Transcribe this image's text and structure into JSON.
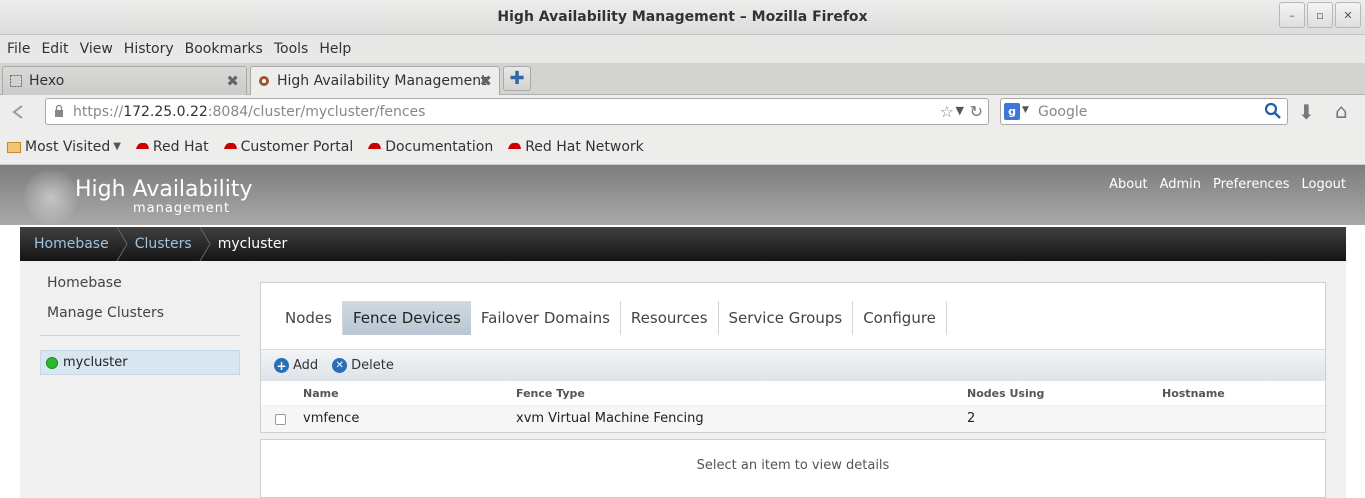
{
  "window": {
    "title": "High Availability Management – Mozilla Firefox"
  },
  "menu": [
    "File",
    "Edit",
    "View",
    "History",
    "Bookmarks",
    "Tools",
    "Help"
  ],
  "tabs": [
    {
      "label": "Hexo"
    },
    {
      "label": "High Availability Management"
    }
  ],
  "nav": {
    "url_prefix": "https://",
    "url_host": "172.25.0.22",
    "url_rest": ":8084/cluster/mycluster/fences",
    "search_placeholder": "Google"
  },
  "bookmarks": [
    "Most Visited",
    "Red Hat",
    "Customer Portal",
    "Documentation",
    "Red Hat Network"
  ],
  "app": {
    "title": "High Availability",
    "subtitle": "management",
    "toplinks": [
      "About",
      "Admin",
      "Preferences",
      "Logout"
    ]
  },
  "breadcrumb": [
    "Homebase",
    "Clusters",
    "mycluster"
  ],
  "sidebar": {
    "links": [
      "Homebase",
      "Manage Clusters"
    ],
    "cluster": "mycluster"
  },
  "panel": {
    "tabs": [
      "Nodes",
      "Fence Devices",
      "Failover Domains",
      "Resources",
      "Service Groups",
      "Configure"
    ],
    "active_tab": "Fence Devices",
    "toolbar": {
      "add": "Add",
      "delete": "Delete"
    },
    "columns": [
      "Name",
      "Fence Type",
      "Nodes Using",
      "Hostname"
    ],
    "rows": [
      {
        "name": "vmfence",
        "type": "xvm Virtual Machine Fencing",
        "nodes": "2",
        "hostname": ""
      }
    ]
  },
  "details": {
    "message": "Select an item to view details"
  },
  "colors": {
    "accent": "#2a6eb8",
    "status_ok": "#2fb52f",
    "crumb_link": "#9ec4e0"
  }
}
